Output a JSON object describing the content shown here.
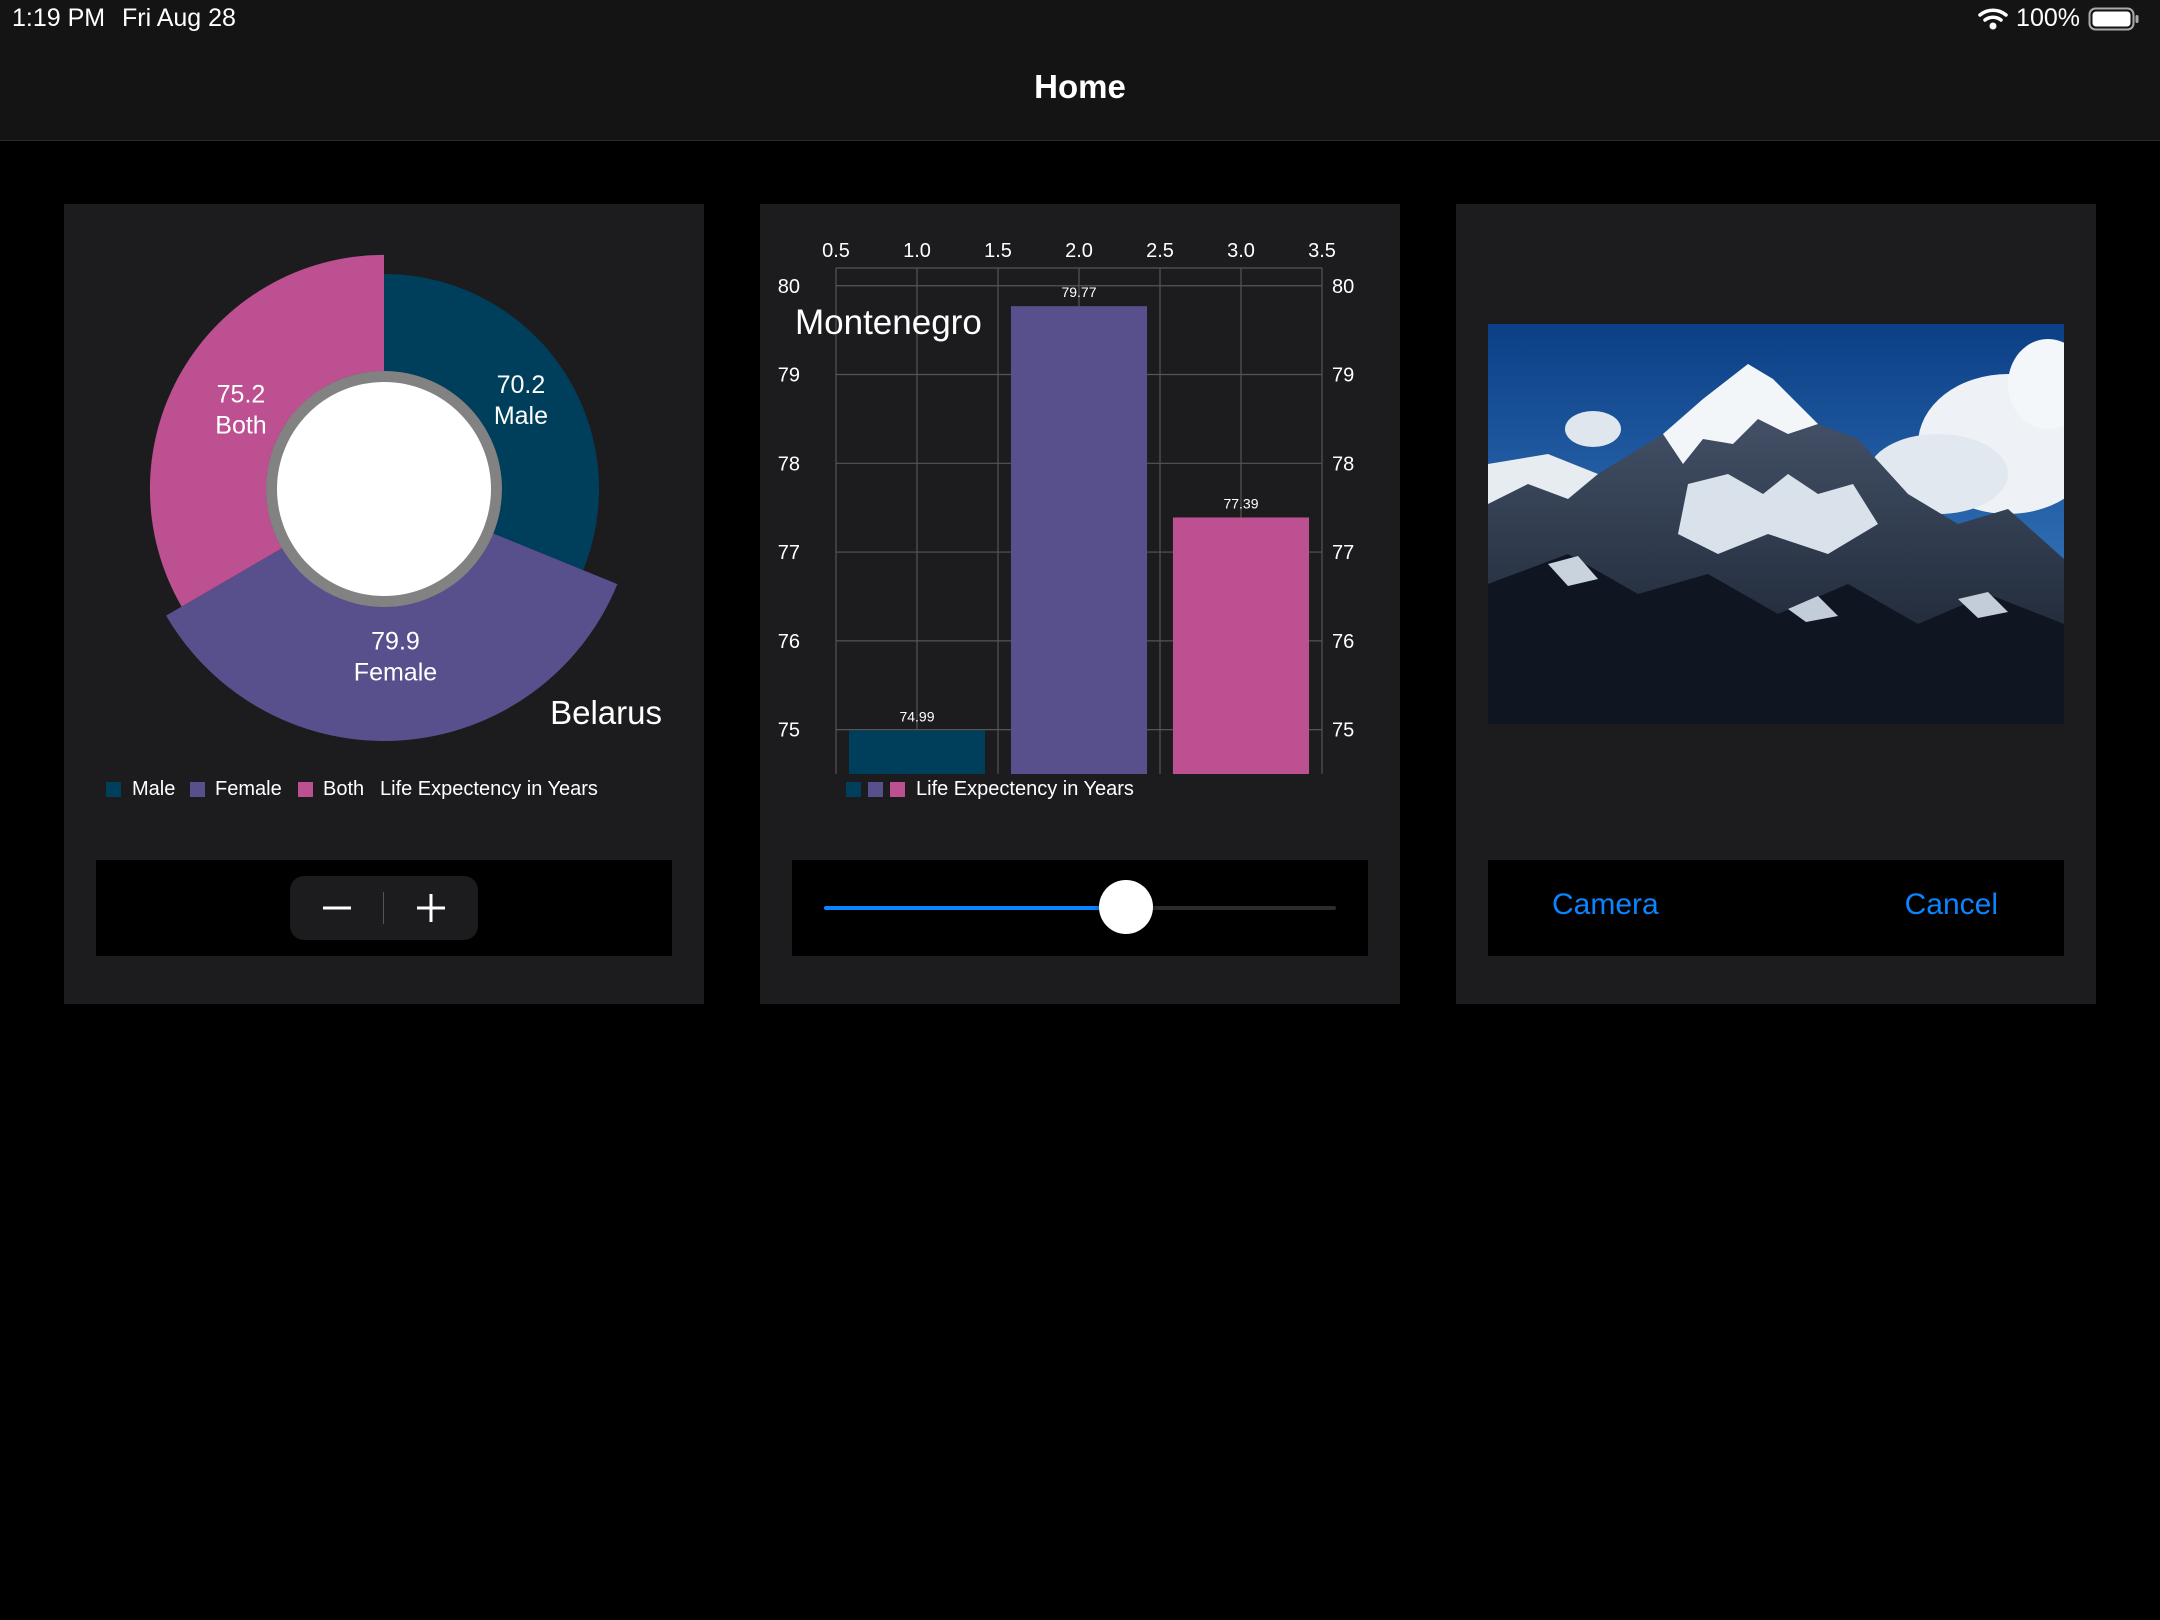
{
  "status_bar": {
    "time": "1:19 PM",
    "date": "Fri Aug 28",
    "battery": "100%"
  },
  "nav": {
    "title": "Home"
  },
  "donut_panel": {
    "stepper": {
      "minus_label": "−",
      "plus_label": "+"
    }
  },
  "bar_panel": {
    "slider": {
      "value": 0.59
    }
  },
  "photo_panel": {
    "camera_label": "Camera",
    "cancel_label": "Cancel"
  },
  "chart_data": [
    {
      "type": "pie",
      "title": "Belarus",
      "legend": [
        "Male",
        "Female",
        "Both"
      ],
      "legend_title": "Life Expectency in Years",
      "slices": [
        {
          "label": "Male",
          "value": 70.2,
          "color": "#003f5c"
        },
        {
          "label": "Female",
          "value": 79.9,
          "color": "#58508d"
        },
        {
          "label": "Both",
          "value": 75.2,
          "color": "#bc5090"
        }
      ]
    },
    {
      "type": "bar",
      "title": "Montenegro",
      "legend_title": "Life Expectency in Years",
      "x_ticks": [
        "0.5",
        "1.0",
        "1.5",
        "2.0",
        "2.5",
        "3.0",
        "3.5"
      ],
      "y_ticks": [
        "75",
        "76",
        "77",
        "78",
        "79",
        "80"
      ],
      "x": [
        1,
        2,
        3
      ],
      "values": [
        74.99,
        79.77,
        77.39
      ],
      "colors": [
        "#003f5c",
        "#58508d",
        "#bc5090"
      ],
      "xlim": [
        0.5,
        3.5
      ],
      "ylim": [
        74.5,
        80.2
      ],
      "grid": true
    }
  ]
}
